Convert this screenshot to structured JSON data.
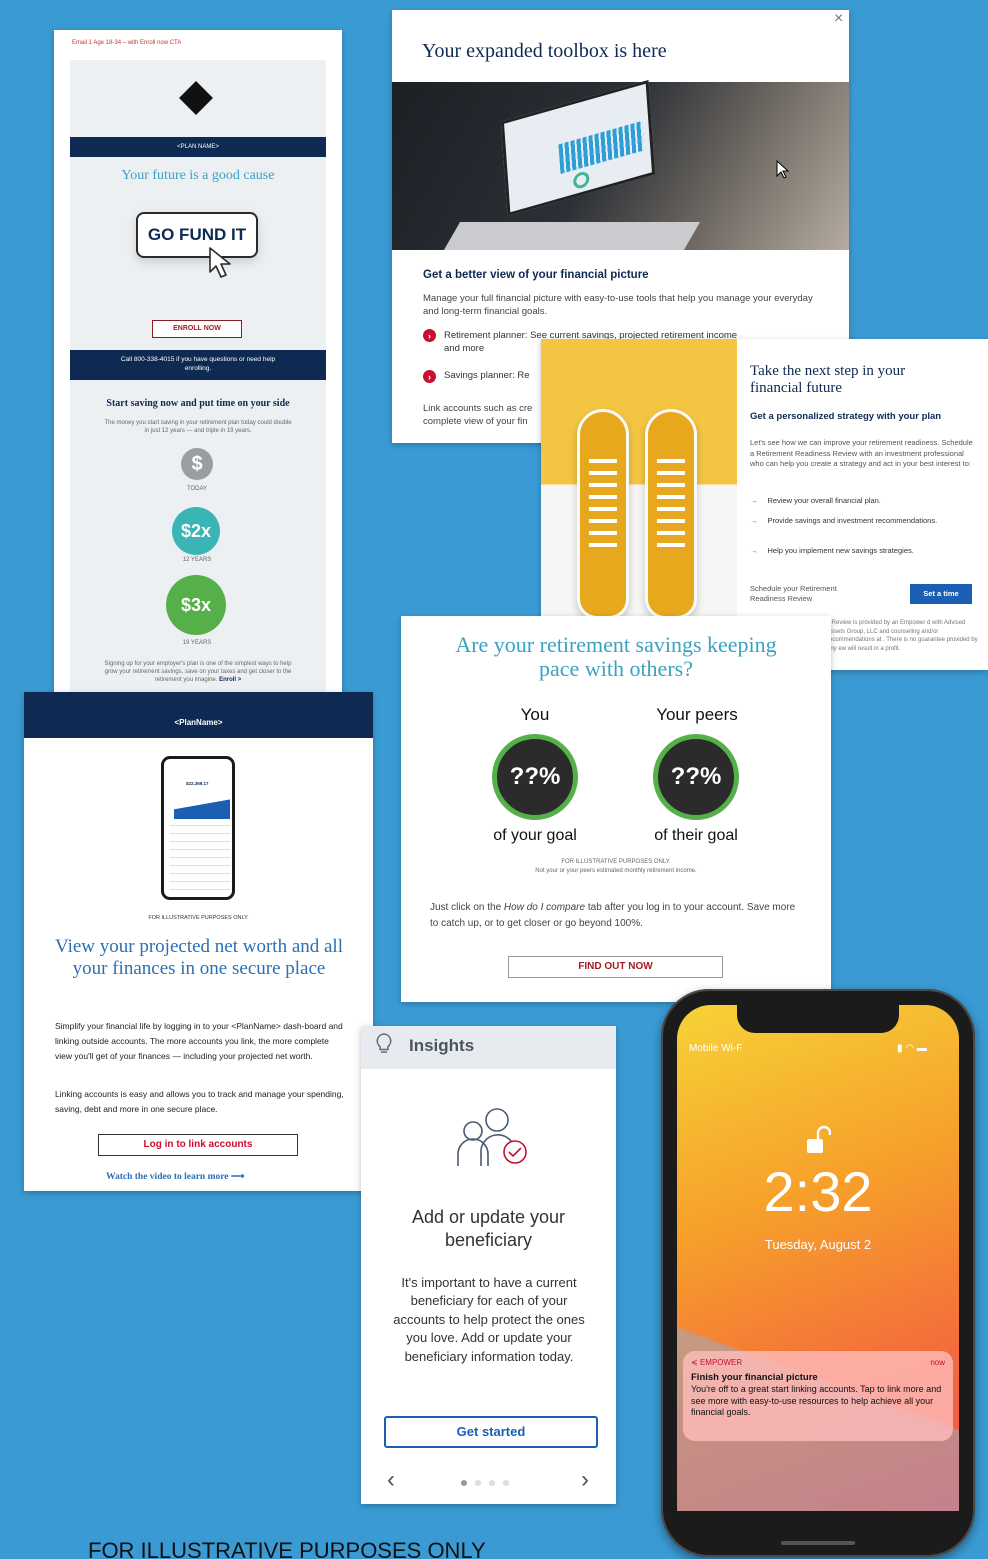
{
  "email_card": {
    "header_note": "Email 1 Age 18-34 – with Enroll now CTA",
    "plan_name": "<PLAN NAME>",
    "headline": "Your future is a good cause",
    "cta_art": "GO FUND IT",
    "enroll_button": "ENROLL NOW",
    "call_banner": "Call 800-338-4015 if you have questions or need help enrolling.",
    "section_title": "Start saving now and put time on your side",
    "section_body": "The money you start saving in your retirement plan today could double in just 12 years — and triple in 19 years.",
    "growth": [
      {
        "symbol": "$",
        "label": "TODAY",
        "color": "#9a9ea2"
      },
      {
        "symbol": "$2x",
        "label": "12 YEARS",
        "color": "#3ab4b4"
      },
      {
        "symbol": "$3x",
        "label": "19 YEARS",
        "color": "#56b04a"
      }
    ],
    "footer_text": "Signing up for your employer's plan is one of the simplest ways to help grow your retirement savings, save on your taxes and get closer to the retirement you imagine.",
    "footer_link": "Enroll >"
  },
  "toolbox_modal": {
    "title": "Your expanded toolbox is here",
    "close_label": "×",
    "subhead": "Get a better view of your financial picture",
    "body": "Manage your full financial picture with easy-to-use tools that help you manage your everyday and long-term financial goals.",
    "bullets": [
      "Retirement planner: See current savings, projected retirement income and more",
      "Savings planner: Re"
    ],
    "footer_text": "Link accounts such as cre complete view of your fin"
  },
  "next_step_card": {
    "title": "Take the next step in your financial future",
    "subhead": "Get a personalized strategy with your plan",
    "body": "Let's see how we can improve your retirement readiness. Schedule a Retirement Readiness Review with an investment professional who can help you create a strategy and act in your best interest to:",
    "bullets": [
      "Review your overall financial plan.",
      "Provide savings and investment recommendations.",
      "Help you implement new savings strategies."
    ],
    "schedule_label": "Schedule your Retirement Readiness Review",
    "button": "Set a time",
    "disclaimer": "s Review is provided by an Empower d with Advised Assets Group, LLC and counseling and/or recommendations at . There is no guarantee provided by any ew will result in a profit."
  },
  "peers_card": {
    "title": "Are your retirement savings keeping pace with others?",
    "you_label": "You",
    "peers_label": "Your peers",
    "you_value": "??%",
    "peers_value": "??%",
    "you_caption": "of your goal",
    "peers_caption": "of their goal",
    "note_line1": "FOR ILLUSTRATIVE PURPOSES ONLY.",
    "note_line2": "Not your or your peers estimated monthly retirement income.",
    "body_pre": "Just click on the ",
    "body_em": "How do I compare",
    "body_post": " tab after you log in to your account. Save more to catch up, or to get closer or go beyond 100%.",
    "button": "FIND OUT NOW"
  },
  "net_worth_card": {
    "plan_name": "<PlanName>",
    "phone_balance": "$22,359.17",
    "illustrative": "FOR ILLUSTRATIVE PURPOSES ONLY.",
    "title": "View your projected net worth and all your finances in one secure place",
    "body1": "Simplify your financial life by logging in to your <PlanName> dash-board and linking outside accounts. The more accounts you link, the more complete view you'll get of your finances — including your projected net worth.",
    "body2": "Linking accounts is easy and allows you to track and manage your spending, saving, debt and more in one secure place.",
    "button": "Log in to link accounts",
    "link": "Watch the video to learn more",
    "link_arrow": "⟶"
  },
  "insights_card": {
    "header": "Insights",
    "title": "Add or update your beneficiary",
    "body": "It's important to have a current beneficiary for each of your accounts to help protect the ones you love. Add or update your beneficiary information today.",
    "button": "Get started",
    "prev": "‹",
    "next": "›",
    "dots": 4,
    "active_dot": 0
  },
  "phone": {
    "carrier": "Mobile Wi-F",
    "time": "2:32",
    "date": "Tuesday, August 2",
    "notification": {
      "app": "EMPOWER",
      "when": "now",
      "title": "Finish your financial picture",
      "body": "You're off to a great start linking accounts. Tap to link more and see more with easy-to-use resources to help achieve all your financial goals."
    }
  },
  "footer_note": "FOR ILLUSTRATIVE PURPOSES ONLY"
}
